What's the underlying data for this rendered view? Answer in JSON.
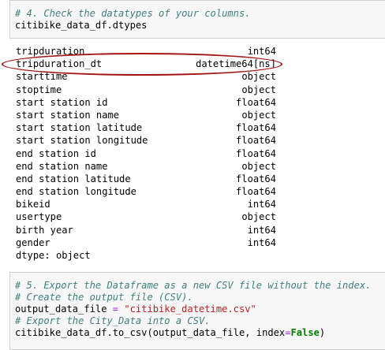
{
  "cell1": {
    "comment": "# 4. Check the datatypes of your columns.",
    "code": "citibike_data_df.dtypes"
  },
  "output": {
    "rows": [
      {
        "name": "tripduration",
        "dtype": "int64"
      },
      {
        "name": "tripduration_dt",
        "dtype": "datetime64[ns]"
      },
      {
        "name": "starttime",
        "dtype": "object"
      },
      {
        "name": "stoptime",
        "dtype": "object"
      },
      {
        "name": "start station id",
        "dtype": "float64"
      },
      {
        "name": "start station name",
        "dtype": "object"
      },
      {
        "name": "start station latitude",
        "dtype": "float64"
      },
      {
        "name": "start station longitude",
        "dtype": "float64"
      },
      {
        "name": "end station id",
        "dtype": "float64"
      },
      {
        "name": "end station name",
        "dtype": "object"
      },
      {
        "name": "end station latitude",
        "dtype": "float64"
      },
      {
        "name": "end station longitude",
        "dtype": "float64"
      },
      {
        "name": "bikeid",
        "dtype": "int64"
      },
      {
        "name": "usertype",
        "dtype": "object"
      },
      {
        "name": "birth year",
        "dtype": "int64"
      },
      {
        "name": "gender",
        "dtype": "int64"
      }
    ],
    "footer": "dtype: object"
  },
  "cell2": {
    "comment1": "# 5. Export the Dataframe as a new CSV file without the index.",
    "comment2": "# Create the output file (CSV).",
    "var1": "output_data_file",
    "assign": " = ",
    "string": "\"citibike_datetime.csv\"",
    "comment3": "# Export the City_Data into a CSV.",
    "call_prefix": "citibike_data_df.to_csv(output_data_file, index",
    "eq": "=",
    "kw_false": "False",
    "close": ")"
  },
  "colors": {
    "comment": "#408080",
    "string": "#ba2121",
    "keyword": "#008000",
    "operator": "#aa22ff",
    "highlight_ring": "#a31515"
  }
}
